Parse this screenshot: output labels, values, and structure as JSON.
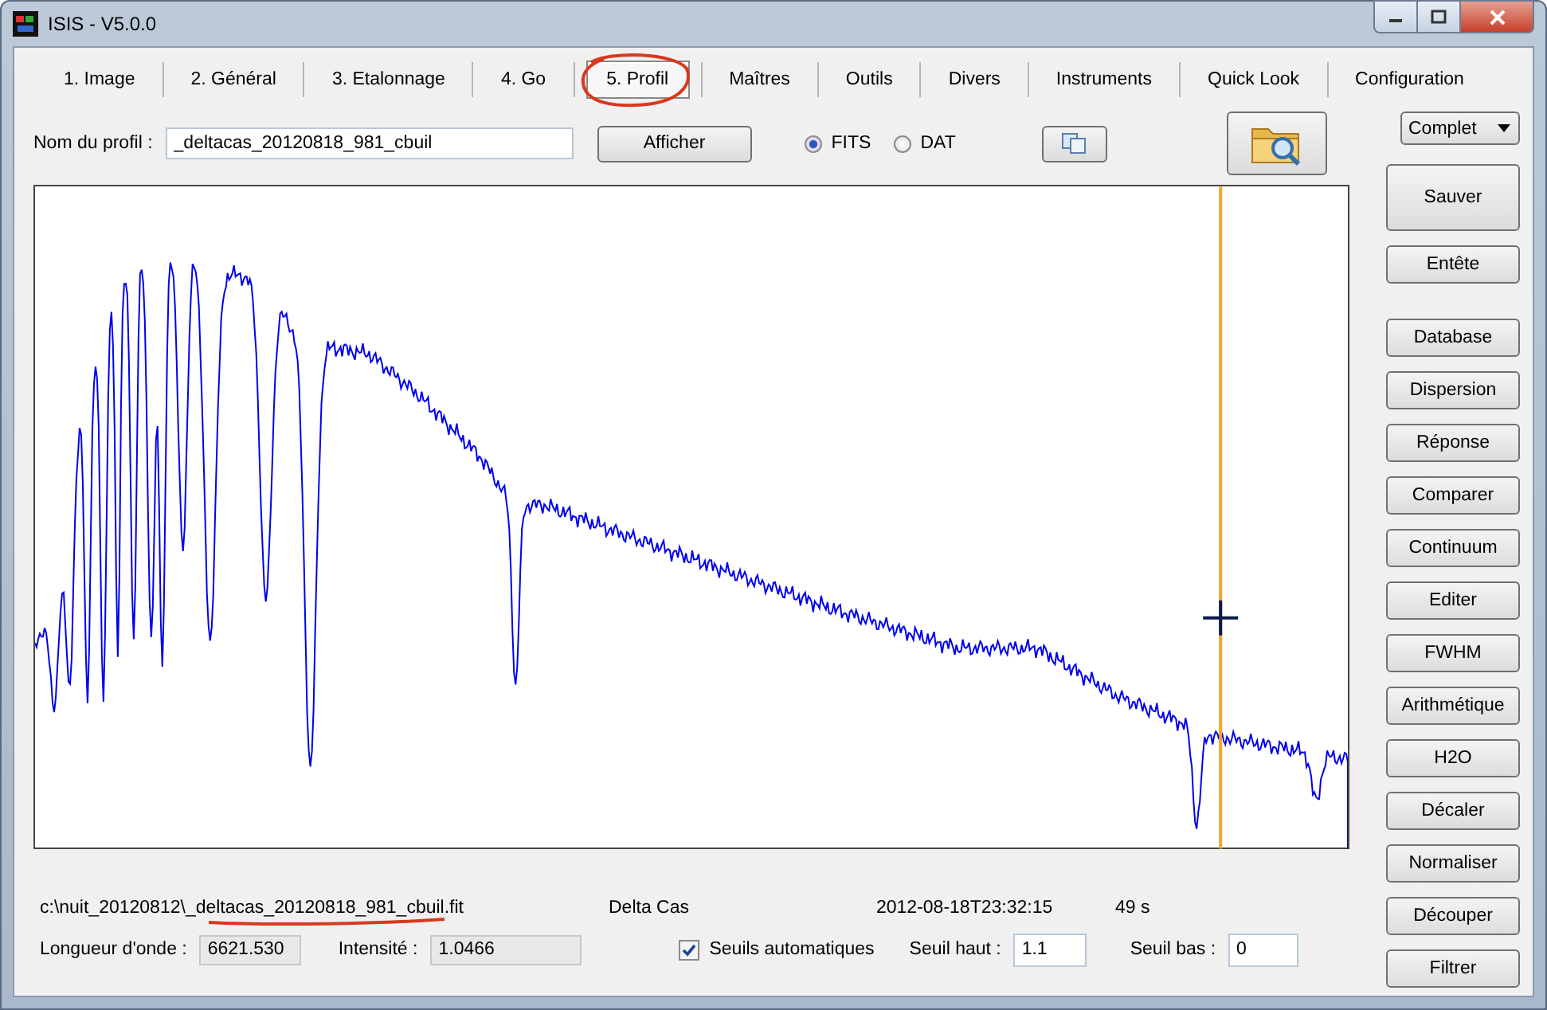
{
  "window": {
    "title": "ISIS - V5.0.0"
  },
  "tabs": [
    {
      "label": "1. Image",
      "selected": false
    },
    {
      "label": "2. Général",
      "selected": false
    },
    {
      "label": "3. Etalonnage",
      "selected": false
    },
    {
      "label": "4. Go",
      "selected": false
    },
    {
      "label": "5. Profil",
      "selected": true
    },
    {
      "label": "Maîtres",
      "selected": false
    },
    {
      "label": "Outils",
      "selected": false
    },
    {
      "label": "Divers",
      "selected": false
    },
    {
      "label": "Instruments",
      "selected": false
    },
    {
      "label": "Quick Look",
      "selected": false
    },
    {
      "label": "Configuration",
      "selected": false
    }
  ],
  "profile": {
    "label": "Nom du profil :",
    "value": "_deltacas_20120818_981_cbuil",
    "display_button": "Afficher",
    "formats": [
      {
        "label": "FITS",
        "selected": true
      },
      {
        "label": "DAT",
        "selected": false
      }
    ]
  },
  "mode_dropdown": {
    "value": "Complet"
  },
  "side_buttons": [
    [
      "Sauver",
      "Entête"
    ],
    [
      "Database",
      "Dispersion",
      "Réponse",
      "Comparer",
      "Continuum",
      "Editer",
      "FWHM",
      "Arithmétique",
      "H2O",
      "Décaler",
      "Normaliser",
      "Découper",
      "Filtrer"
    ]
  ],
  "status": {
    "path": "c:\\nuit_20120812\\_deltacas_20120818_981_cbuil.fit",
    "object": "Delta Cas",
    "date": "2012-08-18T23:32:15",
    "exposure": "49 s"
  },
  "readouts": [
    {
      "label": "Longueur d'onde :",
      "value": "6621.530"
    },
    {
      "label": "Intensité :",
      "value": "1.0466"
    }
  ],
  "auto_threshold": {
    "label": "Seuils automatiques",
    "checked": true
  },
  "thresholds": [
    {
      "label": "Seuil haut :",
      "value": "1.1"
    },
    {
      "label": "Seuil bas :",
      "value": "0"
    }
  ]
}
